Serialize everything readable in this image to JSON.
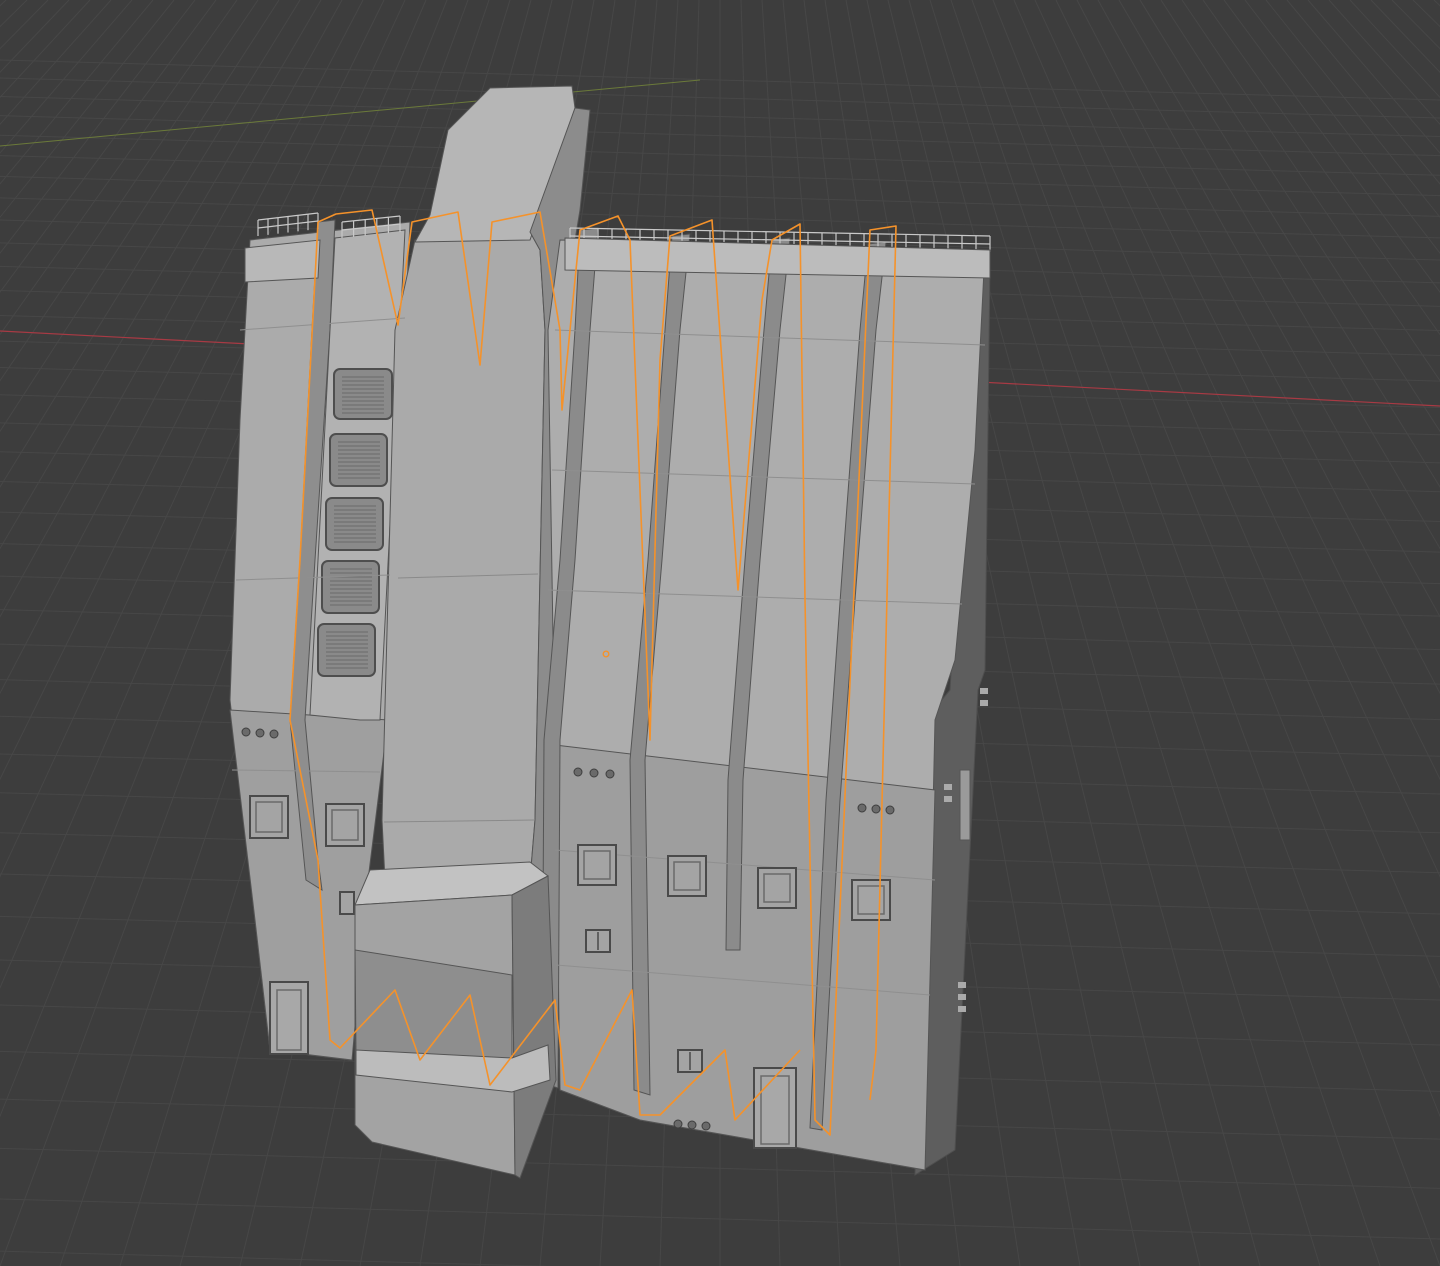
{
  "viewport": {
    "background_color": "#3d3d3d",
    "grid_color": "#4a4a4a",
    "x_axis_color": "#a83a44",
    "y_axis_color": "#6b7a3a",
    "model_face_light": "#b0b0b0",
    "model_face_mid": "#9c9c9c",
    "model_face_dark": "#6e6e6e",
    "model_edge_color": "#5a5a5a",
    "selection_outline_color": "#f5922a",
    "origin_marker_color": "#f5922a",
    "selected_object": "building-mesh",
    "origin_marker_icon": "object-origin-icon"
  }
}
